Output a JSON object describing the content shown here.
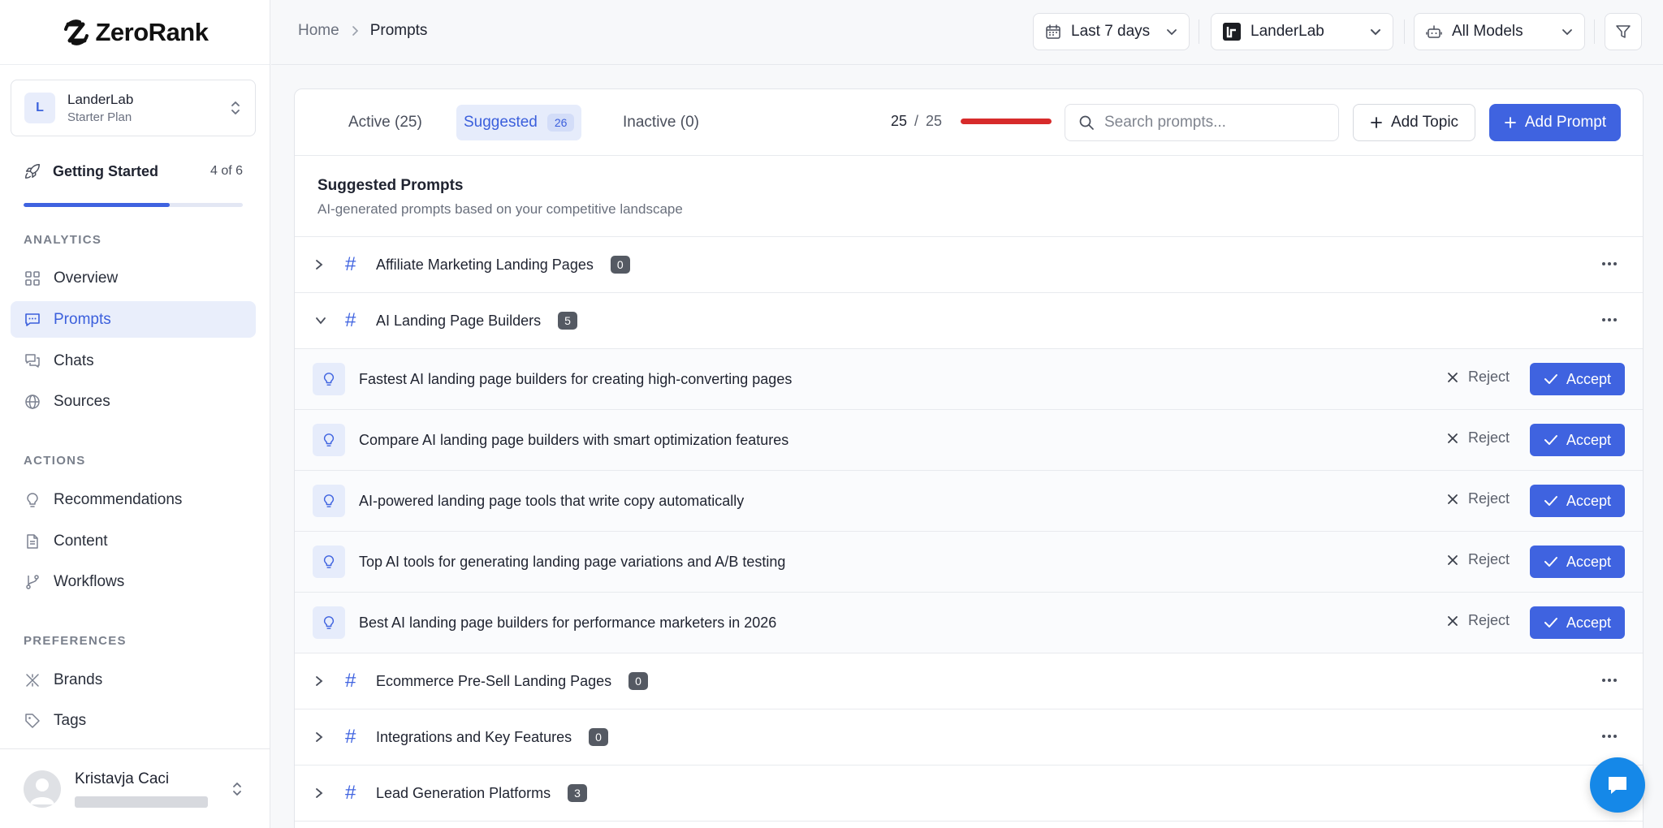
{
  "brand": {
    "name": "ZeroRank"
  },
  "workspace": {
    "initial": "L",
    "name": "LanderLab",
    "plan": "Starter Plan"
  },
  "getting_started": {
    "label": "Getting Started",
    "count": "4 of 6",
    "progress": 0.667
  },
  "sections": {
    "analytics": "ANALYTICS",
    "actions": "ACTIONS",
    "preferences": "PREFERENCES"
  },
  "nav": {
    "overview": "Overview",
    "prompts": "Prompts",
    "chats": "Chats",
    "sources": "Sources",
    "recommendations": "Recommendations",
    "content": "Content",
    "workflows": "Workflows",
    "brands": "Brands",
    "tags": "Tags"
  },
  "user": {
    "name": "Kristavja Caci"
  },
  "breadcrumb": {
    "home": "Home",
    "current": "Prompts"
  },
  "toolbar": {
    "date_range": "Last 7 days",
    "brand": "LanderLab",
    "models": "All Models"
  },
  "tabs": {
    "active": "Active (25)",
    "suggested": "Suggested",
    "suggested_count": "26",
    "inactive": "Inactive (0)"
  },
  "quota": {
    "used": "25",
    "separator": "/",
    "total": "25",
    "fill": 1.0
  },
  "search": {
    "placeholder": "Search prompts..."
  },
  "buttons": {
    "add_topic": "Add Topic",
    "add_prompt": "Add Prompt",
    "reject": "Reject",
    "accept": "Accept"
  },
  "section_header": {
    "title": "Suggested Prompts",
    "subtitle": "AI-generated prompts based on your competitive landscape"
  },
  "topics": [
    {
      "name": "Affiliate Marketing Landing Pages",
      "count": "0"
    },
    {
      "name": "AI Landing Page Builders",
      "count": "5"
    },
    {
      "name": "Ecommerce Pre-Sell Landing Pages",
      "count": "0"
    },
    {
      "name": "Integrations and Key Features",
      "count": "0"
    },
    {
      "name": "Lead Generation Platforms",
      "count": "3"
    }
  ],
  "prompts": [
    "Fastest AI landing page builders for creating high-converting pages",
    "Compare AI landing page builders with smart optimization features",
    "AI-powered landing page tools that write copy automatically",
    "Top AI tools for generating landing page variations and A/B testing",
    "Best AI landing page builders for performance marketers in 2026"
  ],
  "colors": {
    "accent": "#3f63e0",
    "quota_bar": "#d72b2b",
    "chat_fab": "#1588e8"
  },
  "icons": {
    "overview": "grid-icon",
    "prompts": "message-square-icon",
    "chats": "messages-icon",
    "sources": "globe-icon",
    "recommendations": "lightbulb-icon",
    "content": "file-text-icon",
    "workflows": "git-branch-icon",
    "brands": "brand-icon",
    "tags": "tag-icon"
  }
}
